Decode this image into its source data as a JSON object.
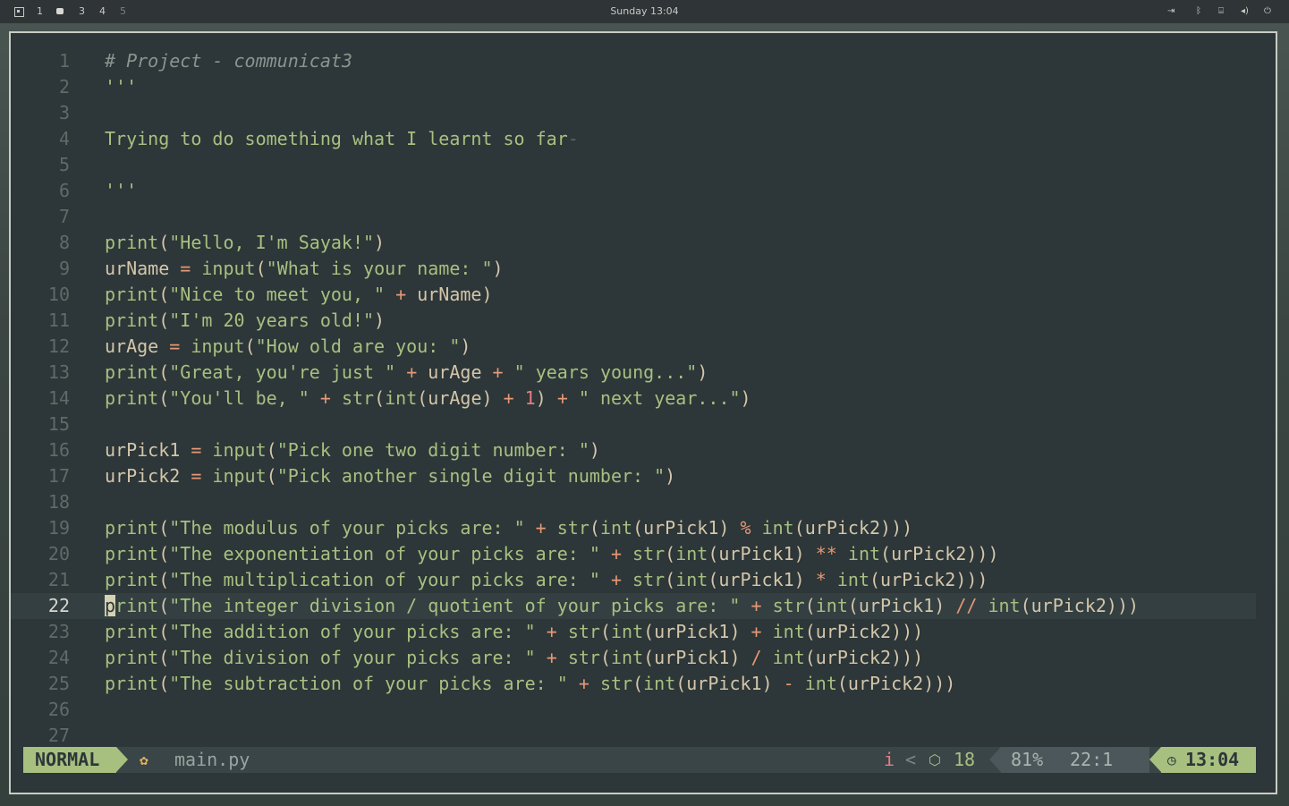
{
  "topbar": {
    "workspaces": [
      "1",
      "3",
      "4",
      "5"
    ],
    "datetime": "Sunday 13:04",
    "tray_icons": [
      "logout-icon",
      "bluetooth-icon",
      "network-icon",
      "volume-icon",
      "power-icon"
    ]
  },
  "editor": {
    "cursor_line": 22,
    "lines": [
      {
        "n": "1"
      },
      {
        "n": "2"
      },
      {
        "n": "3"
      },
      {
        "n": "4"
      },
      {
        "n": "5"
      },
      {
        "n": "6"
      },
      {
        "n": "7"
      },
      {
        "n": "8"
      },
      {
        "n": "9"
      },
      {
        "n": "10"
      },
      {
        "n": "11"
      },
      {
        "n": "12"
      },
      {
        "n": "13"
      },
      {
        "n": "14"
      },
      {
        "n": "15"
      },
      {
        "n": "16"
      },
      {
        "n": "17"
      },
      {
        "n": "18"
      },
      {
        "n": "19"
      },
      {
        "n": "20"
      },
      {
        "n": "21"
      },
      {
        "n": "22"
      },
      {
        "n": "23"
      },
      {
        "n": "24"
      },
      {
        "n": "25"
      },
      {
        "n": "26"
      },
      {
        "n": "27"
      }
    ]
  },
  "statusline": {
    "mode": "NORMAL",
    "filename": "main.py",
    "diagnostic": "i",
    "separator": "<",
    "package_count": "18",
    "percent": "81%",
    "position": "22:1",
    "time": "13:04"
  },
  "colors": {
    "accent_green": "#a7c080",
    "string_green": "#a7c080",
    "operator_orange": "#e69875",
    "background": "#2d3638"
  }
}
